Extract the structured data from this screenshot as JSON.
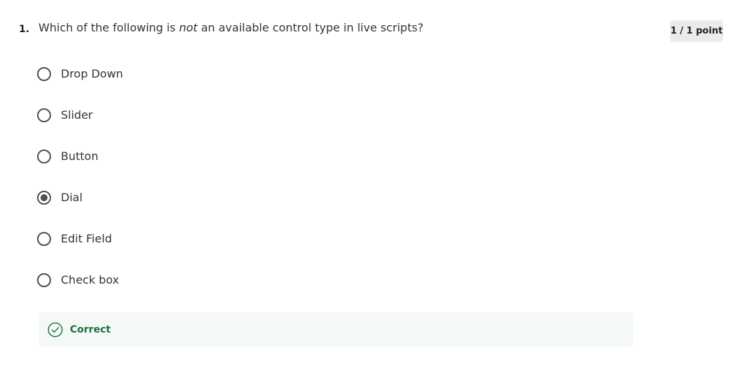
{
  "question": {
    "number": "1.",
    "prompt_before": "Which of the following is ",
    "prompt_emphasis": "not",
    "prompt_after": " an available control type in live scripts?",
    "score": "1 / 1 point"
  },
  "options": [
    {
      "label": "Drop Down",
      "selected": false
    },
    {
      "label": "Slider",
      "selected": false
    },
    {
      "label": "Button",
      "selected": false
    },
    {
      "label": "Dial",
      "selected": true
    },
    {
      "label": "Edit Field",
      "selected": false
    },
    {
      "label": "Check box",
      "selected": false
    }
  ],
  "feedback": {
    "label": "Correct",
    "icon": "check-circle-icon",
    "color": "#1f6b3d",
    "background": "#f4f9f5"
  },
  "colors": {
    "text": "#333333",
    "radio": "#4f4f4f",
    "badge_background": "#ebebeb"
  }
}
